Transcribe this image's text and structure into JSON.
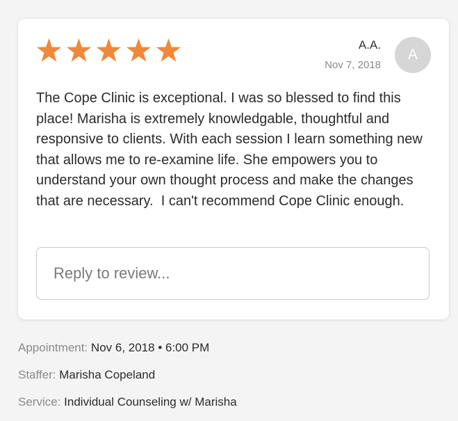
{
  "colors": {
    "star": "#f0883a",
    "avatar_bg": "#d6d6d6"
  },
  "review": {
    "rating": 5,
    "max_rating": 5,
    "star_icon": "star-icon",
    "reviewer_name": "A.A.",
    "date": "Nov 7, 2018",
    "avatar_initial": "A",
    "text": "The Cope Clinic is exceptional. I was so blessed to find this place! Marisha is extremely knowledgable, thoughtful and responsive to clients. With each session I learn something new that allows me to re-examine life. She empowers you to understand your own thought process and make the changes that are necessary.  I can't recommend Cope Clinic enough.",
    "reply_placeholder": "Reply to review..."
  },
  "details": {
    "appointment_label": "Appointment:",
    "appointment_value": "Nov 6, 2018 • 6:00 PM",
    "staffer_label": "Staffer:",
    "staffer_value": "Marisha Copeland",
    "service_label": "Service:",
    "service_value": "Individual Counseling w/ Marisha"
  }
}
